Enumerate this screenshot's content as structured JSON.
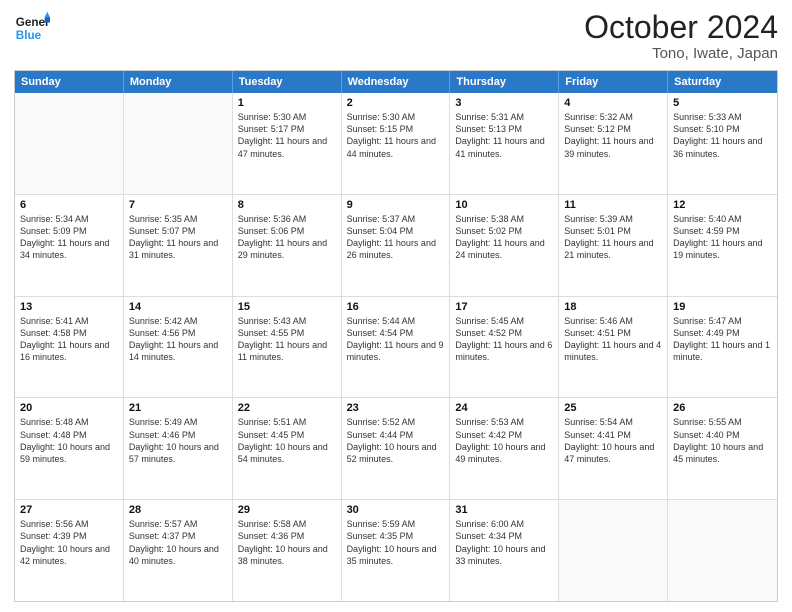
{
  "header": {
    "logo_general": "General",
    "logo_blue": "Blue",
    "title": "October 2024",
    "subtitle": "Tono, Iwate, Japan"
  },
  "days_of_week": [
    "Sunday",
    "Monday",
    "Tuesday",
    "Wednesday",
    "Thursday",
    "Friday",
    "Saturday"
  ],
  "rows": [
    [
      {
        "day": "",
        "info": "",
        "empty": true
      },
      {
        "day": "",
        "info": "",
        "empty": true
      },
      {
        "day": "1",
        "info": "Sunrise: 5:30 AM\nSunset: 5:17 PM\nDaylight: 11 hours and 47 minutes."
      },
      {
        "day": "2",
        "info": "Sunrise: 5:30 AM\nSunset: 5:15 PM\nDaylight: 11 hours and 44 minutes."
      },
      {
        "day": "3",
        "info": "Sunrise: 5:31 AM\nSunset: 5:13 PM\nDaylight: 11 hours and 41 minutes."
      },
      {
        "day": "4",
        "info": "Sunrise: 5:32 AM\nSunset: 5:12 PM\nDaylight: 11 hours and 39 minutes."
      },
      {
        "day": "5",
        "info": "Sunrise: 5:33 AM\nSunset: 5:10 PM\nDaylight: 11 hours and 36 minutes."
      }
    ],
    [
      {
        "day": "6",
        "info": "Sunrise: 5:34 AM\nSunset: 5:09 PM\nDaylight: 11 hours and 34 minutes."
      },
      {
        "day": "7",
        "info": "Sunrise: 5:35 AM\nSunset: 5:07 PM\nDaylight: 11 hours and 31 minutes."
      },
      {
        "day": "8",
        "info": "Sunrise: 5:36 AM\nSunset: 5:06 PM\nDaylight: 11 hours and 29 minutes."
      },
      {
        "day": "9",
        "info": "Sunrise: 5:37 AM\nSunset: 5:04 PM\nDaylight: 11 hours and 26 minutes."
      },
      {
        "day": "10",
        "info": "Sunrise: 5:38 AM\nSunset: 5:02 PM\nDaylight: 11 hours and 24 minutes."
      },
      {
        "day": "11",
        "info": "Sunrise: 5:39 AM\nSunset: 5:01 PM\nDaylight: 11 hours and 21 minutes."
      },
      {
        "day": "12",
        "info": "Sunrise: 5:40 AM\nSunset: 4:59 PM\nDaylight: 11 hours and 19 minutes."
      }
    ],
    [
      {
        "day": "13",
        "info": "Sunrise: 5:41 AM\nSunset: 4:58 PM\nDaylight: 11 hours and 16 minutes."
      },
      {
        "day": "14",
        "info": "Sunrise: 5:42 AM\nSunset: 4:56 PM\nDaylight: 11 hours and 14 minutes."
      },
      {
        "day": "15",
        "info": "Sunrise: 5:43 AM\nSunset: 4:55 PM\nDaylight: 11 hours and 11 minutes."
      },
      {
        "day": "16",
        "info": "Sunrise: 5:44 AM\nSunset: 4:54 PM\nDaylight: 11 hours and 9 minutes."
      },
      {
        "day": "17",
        "info": "Sunrise: 5:45 AM\nSunset: 4:52 PM\nDaylight: 11 hours and 6 minutes."
      },
      {
        "day": "18",
        "info": "Sunrise: 5:46 AM\nSunset: 4:51 PM\nDaylight: 11 hours and 4 minutes."
      },
      {
        "day": "19",
        "info": "Sunrise: 5:47 AM\nSunset: 4:49 PM\nDaylight: 11 hours and 1 minute."
      }
    ],
    [
      {
        "day": "20",
        "info": "Sunrise: 5:48 AM\nSunset: 4:48 PM\nDaylight: 10 hours and 59 minutes."
      },
      {
        "day": "21",
        "info": "Sunrise: 5:49 AM\nSunset: 4:46 PM\nDaylight: 10 hours and 57 minutes."
      },
      {
        "day": "22",
        "info": "Sunrise: 5:51 AM\nSunset: 4:45 PM\nDaylight: 10 hours and 54 minutes."
      },
      {
        "day": "23",
        "info": "Sunrise: 5:52 AM\nSunset: 4:44 PM\nDaylight: 10 hours and 52 minutes."
      },
      {
        "day": "24",
        "info": "Sunrise: 5:53 AM\nSunset: 4:42 PM\nDaylight: 10 hours and 49 minutes."
      },
      {
        "day": "25",
        "info": "Sunrise: 5:54 AM\nSunset: 4:41 PM\nDaylight: 10 hours and 47 minutes."
      },
      {
        "day": "26",
        "info": "Sunrise: 5:55 AM\nSunset: 4:40 PM\nDaylight: 10 hours and 45 minutes."
      }
    ],
    [
      {
        "day": "27",
        "info": "Sunrise: 5:56 AM\nSunset: 4:39 PM\nDaylight: 10 hours and 42 minutes."
      },
      {
        "day": "28",
        "info": "Sunrise: 5:57 AM\nSunset: 4:37 PM\nDaylight: 10 hours and 40 minutes."
      },
      {
        "day": "29",
        "info": "Sunrise: 5:58 AM\nSunset: 4:36 PM\nDaylight: 10 hours and 38 minutes."
      },
      {
        "day": "30",
        "info": "Sunrise: 5:59 AM\nSunset: 4:35 PM\nDaylight: 10 hours and 35 minutes."
      },
      {
        "day": "31",
        "info": "Sunrise: 6:00 AM\nSunset: 4:34 PM\nDaylight: 10 hours and 33 minutes."
      },
      {
        "day": "",
        "info": "",
        "empty": true
      },
      {
        "day": "",
        "info": "",
        "empty": true
      }
    ]
  ]
}
